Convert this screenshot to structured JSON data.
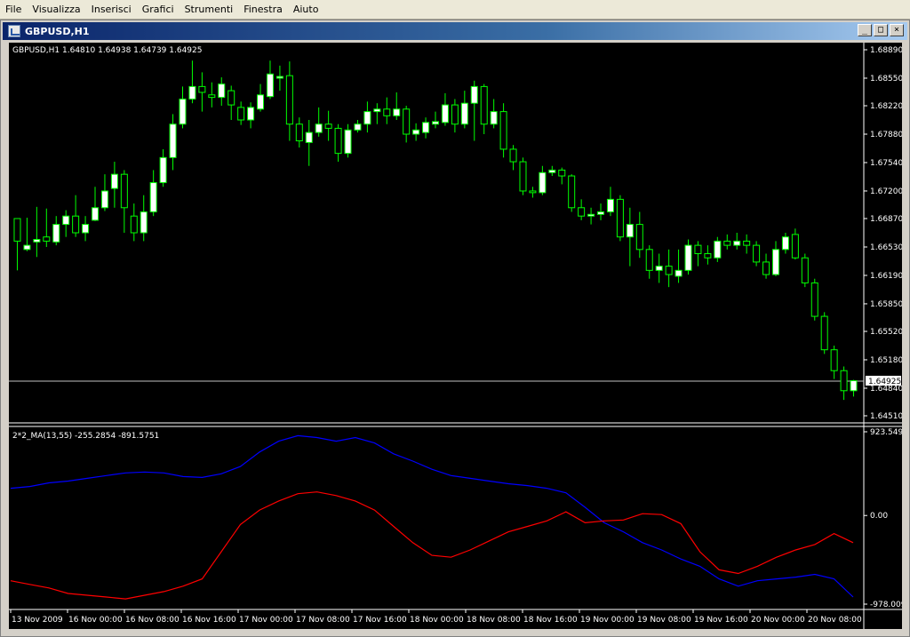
{
  "menu": [
    "File",
    "Visualizza",
    "Inserisci",
    "Grafici",
    "Strumenti",
    "Finestra",
    "Aiuto"
  ],
  "window": {
    "title": "GBPUSD,H1",
    "buttons": [
      "_",
      "□",
      "×"
    ]
  },
  "colors": {
    "background": "#000000",
    "bull_candle": "#ffffff",
    "bear_candle": "#000000",
    "candle_outline": "#00ff00",
    "ma_fast": "#0000ff",
    "ma_slow": "#ff0000",
    "axis_text": "#ffffff"
  },
  "chart_data": [
    {
      "type": "candlestick",
      "title": "GBPUSD,H1  1.64810 1.64938 1.64739 1.64925",
      "ylim": [
        1.6451,
        1.6889
      ],
      "y_ticks": [
        "1.68890",
        "1.68550",
        "1.68220",
        "1.67880",
        "1.67540",
        "1.67200",
        "1.66870",
        "1.66530",
        "1.66190",
        "1.65850",
        "1.65520",
        "1.65180",
        "1.64840",
        "1.64510"
      ],
      "current_price": "1.64925",
      "candles": [
        [
          1.6687,
          1.666,
          1.6685,
          1.6625
        ],
        [
          1.665,
          1.6655,
          1.6688,
          1.6648
        ],
        [
          1.6659,
          1.6662,
          1.6701,
          1.6641
        ],
        [
          1.6665,
          1.666,
          1.6699,
          1.6653
        ],
        [
          1.6659,
          1.668,
          1.669,
          1.6655
        ],
        [
          1.668,
          1.669,
          1.6697,
          1.6665
        ],
        [
          1.669,
          1.667,
          1.6715,
          1.6665
        ],
        [
          1.667,
          1.668,
          1.669,
          1.666
        ],
        [
          1.6685,
          1.67,
          1.6725,
          1.6684
        ],
        [
          1.67,
          1.672,
          1.674,
          1.6696
        ],
        [
          1.6723,
          1.674,
          1.6755,
          1.67
        ],
        [
          1.674,
          1.67,
          1.6745,
          1.667
        ],
        [
          1.669,
          1.667,
          1.6705,
          1.666
        ],
        [
          1.667,
          1.6695,
          1.6715,
          1.666
        ],
        [
          1.6695,
          1.673,
          1.6745,
          1.669
        ],
        [
          1.673,
          1.676,
          1.677,
          1.6725
        ],
        [
          1.676,
          1.68,
          1.6812,
          1.6745
        ],
        [
          1.68,
          1.683,
          1.6845,
          1.6795
        ],
        [
          1.683,
          1.6845,
          1.6876,
          1.6825
        ],
        [
          1.6845,
          1.6838,
          1.6862,
          1.6815
        ],
        [
          1.6835,
          1.6832,
          1.685,
          1.682
        ],
        [
          1.6832,
          1.6848,
          1.6856,
          1.6822
        ],
        [
          1.684,
          1.6823,
          1.6846,
          1.6805
        ],
        [
          1.682,
          1.6805,
          1.6827,
          1.6799
        ],
        [
          1.6805,
          1.682,
          1.6826,
          1.6795
        ],
        [
          1.6818,
          1.6835,
          1.6848,
          1.6815
        ],
        [
          1.6833,
          1.686,
          1.6876,
          1.683
        ],
        [
          1.6855,
          1.6857,
          1.687,
          1.684
        ],
        [
          1.6858,
          1.68,
          1.6875,
          1.678
        ],
        [
          1.68,
          1.678,
          1.6808,
          1.6772
        ],
        [
          1.6778,
          1.679,
          1.6805,
          1.675
        ],
        [
          1.679,
          1.68,
          1.682,
          1.6785
        ],
        [
          1.68,
          1.6795,
          1.6816,
          1.678
        ],
        [
          1.6795,
          1.6765,
          1.68,
          1.6755
        ],
        [
          1.6765,
          1.6793,
          1.68,
          1.676
        ],
        [
          1.6793,
          1.68,
          1.6805,
          1.679
        ],
        [
          1.68,
          1.6815,
          1.6827,
          1.679
        ],
        [
          1.6815,
          1.6818,
          1.6825,
          1.68
        ],
        [
          1.6818,
          1.681,
          1.6832,
          1.68
        ],
        [
          1.681,
          1.6818,
          1.6838,
          1.6805
        ],
        [
          1.6818,
          1.6788,
          1.6822,
          1.6778
        ],
        [
          1.6788,
          1.6793,
          1.6801,
          1.678
        ],
        [
          1.679,
          1.6802,
          1.6808,
          1.6783
        ],
        [
          1.68,
          1.6803,
          1.6815,
          1.6795
        ],
        [
          1.6802,
          1.6823,
          1.6837,
          1.6798
        ],
        [
          1.6823,
          1.68,
          1.683,
          1.679
        ],
        [
          1.68,
          1.6825,
          1.684,
          1.6795
        ],
        [
          1.6825,
          1.6845,
          1.6852,
          1.678
        ],
        [
          1.6845,
          1.68,
          1.6848,
          1.6788
        ],
        [
          1.68,
          1.6815,
          1.683,
          1.6795
        ],
        [
          1.6815,
          1.677,
          1.6825,
          1.676
        ],
        [
          1.677,
          1.6755,
          1.6775,
          1.6745
        ],
        [
          1.6755,
          1.672,
          1.676,
          1.6715
        ],
        [
          1.672,
          1.6718,
          1.6725,
          1.6712
        ],
        [
          1.6718,
          1.6742,
          1.675,
          1.6715
        ],
        [
          1.6742,
          1.6745,
          1.675,
          1.6738
        ],
        [
          1.6745,
          1.6738,
          1.6748,
          1.6728
        ],
        [
          1.6738,
          1.67,
          1.674,
          1.6695
        ],
        [
          1.67,
          1.669,
          1.671,
          1.6685
        ],
        [
          1.669,
          1.6692,
          1.67,
          1.668
        ],
        [
          1.6692,
          1.6695,
          1.6705,
          1.6685
        ],
        [
          1.6695,
          1.671,
          1.6725,
          1.669
        ],
        [
          1.671,
          1.6665,
          1.6715,
          1.666
        ],
        [
          1.6665,
          1.668,
          1.67,
          1.663
        ],
        [
          1.668,
          1.665,
          1.6695,
          1.664
        ],
        [
          1.665,
          1.6625,
          1.6655,
          1.6615
        ],
        [
          1.6625,
          1.663,
          1.6645,
          1.661
        ],
        [
          1.663,
          1.662,
          1.665,
          1.6605
        ],
        [
          1.6618,
          1.6625,
          1.665,
          1.661
        ],
        [
          1.6625,
          1.6655,
          1.6662,
          1.662
        ],
        [
          1.6655,
          1.6645,
          1.666,
          1.663
        ],
        [
          1.6645,
          1.664,
          1.6655,
          1.6632
        ],
        [
          1.664,
          1.666,
          1.6665,
          1.6635
        ],
        [
          1.666,
          1.6655,
          1.6668,
          1.665
        ],
        [
          1.6655,
          1.666,
          1.667,
          1.665
        ],
        [
          1.666,
          1.6655,
          1.6668,
          1.6645
        ],
        [
          1.6655,
          1.6635,
          1.666,
          1.663
        ],
        [
          1.6635,
          1.662,
          1.6645,
          1.6615
        ],
        [
          1.662,
          1.665,
          1.666,
          1.6618
        ],
        [
          1.665,
          1.6665,
          1.667,
          1.6645
        ],
        [
          1.6668,
          1.664,
          1.6675,
          1.6638
        ],
        [
          1.664,
          1.661,
          1.6645,
          1.6605
        ],
        [
          1.661,
          1.657,
          1.6615,
          1.6565
        ],
        [
          1.657,
          1.653,
          1.6575,
          1.6525
        ],
        [
          1.653,
          1.6505,
          1.6535,
          1.6495
        ],
        [
          1.6505,
          1.6481,
          1.651,
          1.647
        ],
        [
          1.6481,
          1.6493,
          1.6494,
          1.6474
        ]
      ]
    },
    {
      "type": "line",
      "title": "2*2_MA(13,55) -255.2854 -891.5751",
      "ylim": [
        -978.009,
        923.5496
      ],
      "y_ticks": [
        "923.5496",
        "0.00",
        "-978.009"
      ],
      "x_ticks": [
        "13 Nov 2009",
        "16 Nov 00:00",
        "16 Nov 08:00",
        "16 Nov 16:00",
        "17 Nov 00:00",
        "17 Nov 08:00",
        "17 Nov 16:00",
        "18 Nov 00:00",
        "18 Nov 08:00",
        "18 Nov 16:00",
        "19 Nov 00:00",
        "19 Nov 08:00",
        "19 Nov 16:00",
        "20 Nov 00:00",
        "20 Nov 08:00"
      ],
      "series": [
        {
          "color": "#0000ff",
          "values": [
            300,
            320,
            360,
            380,
            410,
            440,
            470,
            480,
            470,
            430,
            420,
            460,
            540,
            700,
            820,
            880,
            860,
            820,
            860,
            800,
            680,
            600,
            510,
            440,
            410,
            380,
            350,
            330,
            300,
            250,
            90,
            -80,
            -180,
            -300,
            -380,
            -480,
            -560,
            -700,
            -780,
            -720,
            -700,
            -680,
            -650,
            -700,
            -900
          ]
        },
        {
          "color": "#ff0000",
          "values": [
            -720,
            -760,
            -800,
            -860,
            -880,
            -900,
            -920,
            -880,
            -840,
            -780,
            -700,
            -400,
            -100,
            60,
            160,
            240,
            260,
            220,
            160,
            60,
            -120,
            -300,
            -440,
            -460,
            -380,
            -280,
            -180,
            -120,
            -60,
            40,
            -80,
            -60,
            -50,
            20,
            10,
            -90,
            -400,
            -600,
            -640,
            -560,
            -460,
            -380,
            -320,
            -200,
            -300
          ]
        }
      ]
    }
  ]
}
